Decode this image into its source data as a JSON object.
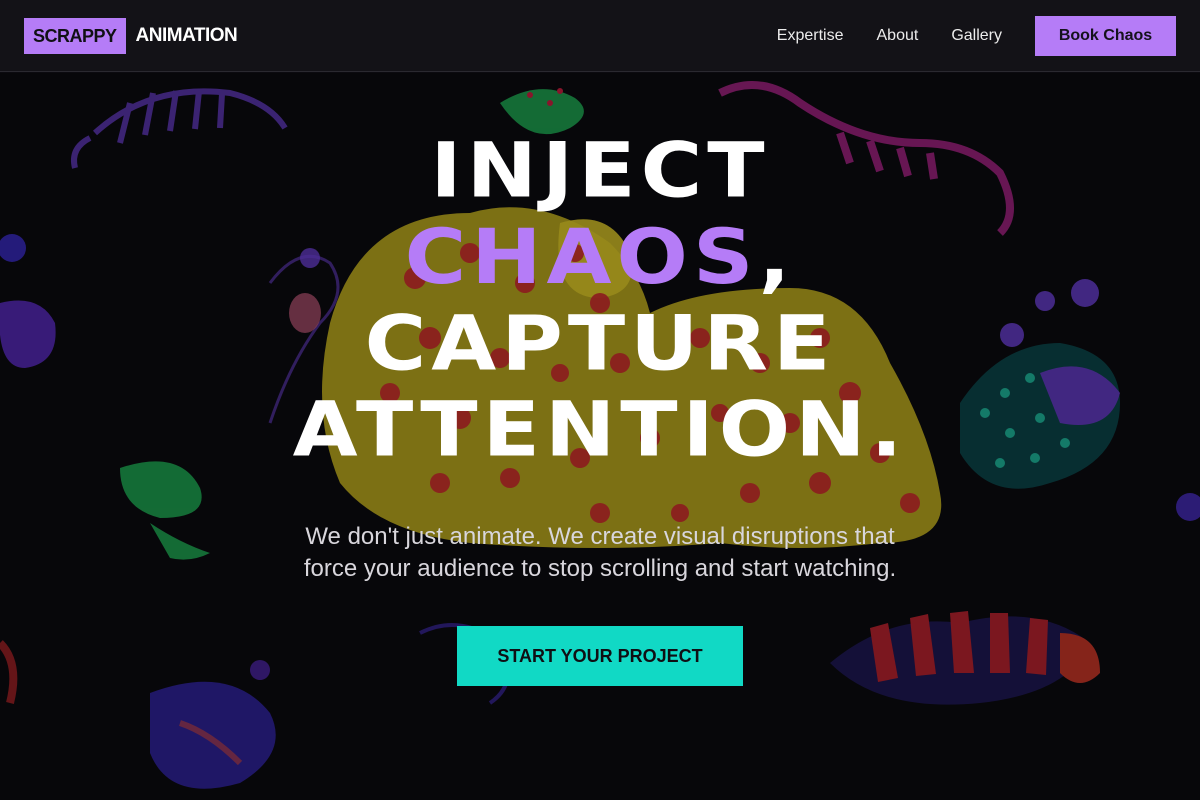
{
  "brand": {
    "box_text": "SCRAPPY",
    "text": "ANIMATION"
  },
  "nav": {
    "links": [
      "Expertise",
      "About",
      "Gallery"
    ],
    "cta_label": "Book Chaos"
  },
  "hero": {
    "headline": {
      "line1": "INJECT",
      "line2_accent": "CHAOS",
      "line2_rest": ",",
      "line3": "CAPTURE",
      "line4": "ATTENTION."
    },
    "subtext_line1": "We don't just animate. We create visual disruptions that",
    "subtext_line2": "force your audience to stop scrolling and start watching.",
    "cta_label": "START YOUR PROJECT"
  },
  "colors": {
    "accent_purple": "#b57cf7",
    "accent_teal": "#11d9c5",
    "background": "#0b0a0f"
  }
}
